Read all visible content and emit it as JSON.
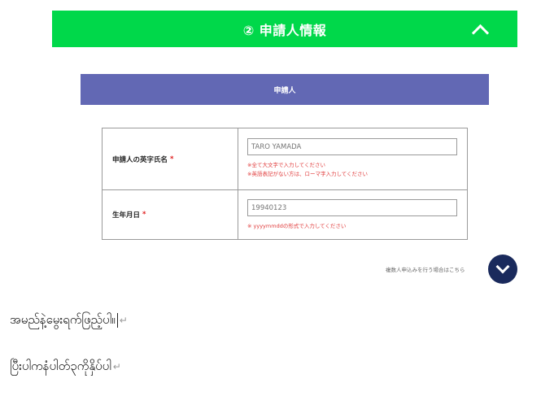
{
  "section": {
    "title": "② 申請人情報",
    "chevron_icon": "chevron-up-icon",
    "bg_color": "#00d84a"
  },
  "subsection": {
    "title": "申請人",
    "bg_color": "#6268b4"
  },
  "form": {
    "name": {
      "label": "申請人の英字氏名",
      "required_mark": "*",
      "placeholder": "TARO YAMADA",
      "hint1": "※全て大文字で入力してください",
      "hint2": "※英語表記がない方は、ローマ字入力してください"
    },
    "birthdate": {
      "label": "生年月日",
      "required_mark": "*",
      "placeholder": "19940123",
      "hint1": "※ yyyymmddの形式で入力してください"
    }
  },
  "multi_applicant": {
    "text": "複数人申込みを行う場合はこちら",
    "icon": "chevron-down-icon"
  },
  "document_lines": [
    "အမည်နဲ့မွေးရက်ဖြည့်ပါ။",
    "ပြီးပါကနံပါတ်၃ကိုနှိပ်ပါ"
  ]
}
